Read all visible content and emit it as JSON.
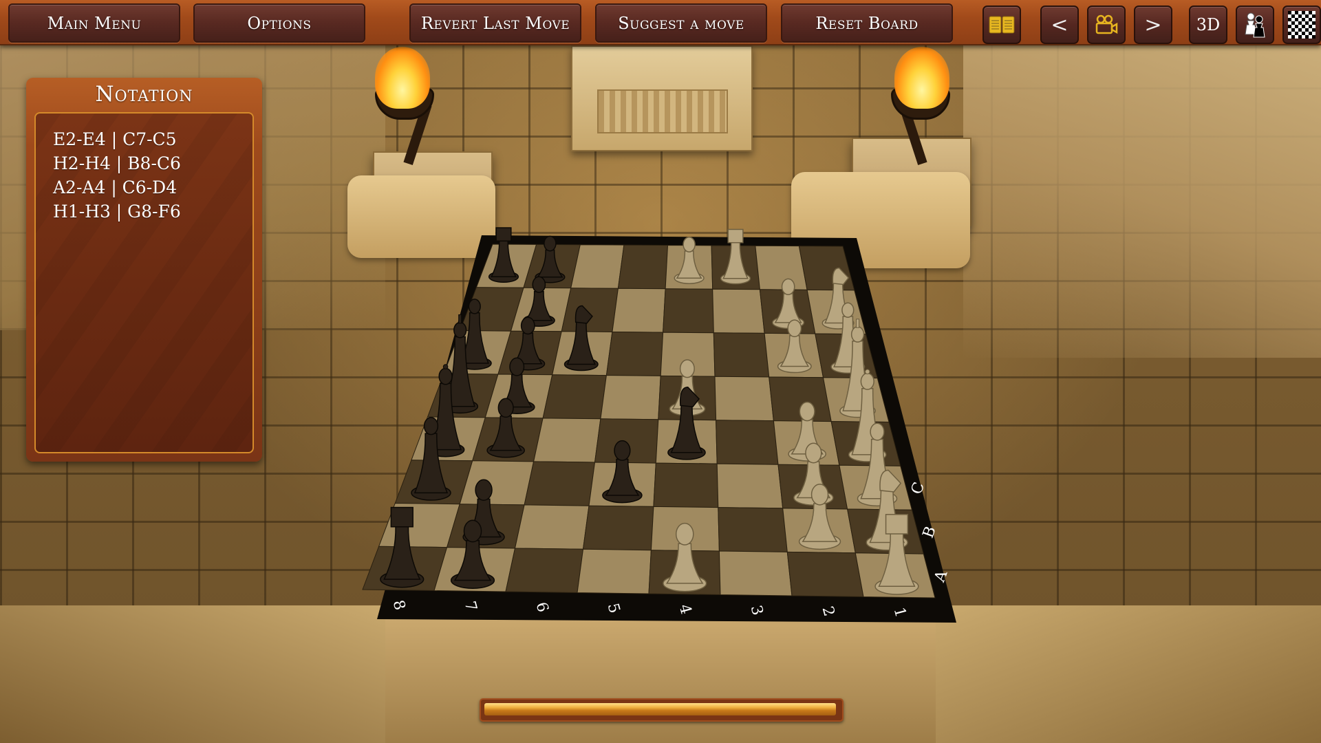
{
  "toolbar": {
    "buttons": [
      {
        "id": "main-menu",
        "label": "Main Menu"
      },
      {
        "id": "options",
        "label": "Options"
      },
      {
        "id": "revert-last-move",
        "label": "Revert Last Move"
      },
      {
        "id": "suggest-move",
        "label": "Suggest a move"
      },
      {
        "id": "reset-board",
        "label": "Reset Board"
      }
    ],
    "icons": [
      {
        "id": "notation-book",
        "icon": "open-book-icon",
        "glyph": "📖"
      },
      {
        "id": "previous",
        "icon": "chevron-left-icon",
        "glyph": "<"
      },
      {
        "id": "camera",
        "icon": "movie-camera-icon",
        "glyph": "🎥"
      },
      {
        "id": "next",
        "icon": "chevron-right-icon",
        "glyph": ">"
      },
      {
        "id": "view-3d",
        "icon": "3d-toggle-icon",
        "glyph": "3D"
      },
      {
        "id": "pieces",
        "icon": "pawns-icon",
        "glyph": "♟"
      },
      {
        "id": "board-style",
        "icon": "checkerboard-icon",
        "glyph": ""
      }
    ]
  },
  "notation": {
    "title": "Notation",
    "moves": [
      "E2-E4 | C7-C5",
      "H2-H4 | B8-C6",
      "A2-A4 | C6-D4",
      "H1-H3 | G8-F6"
    ]
  },
  "board": {
    "rank_labels": [
      "8",
      "7",
      "6",
      "5",
      "4",
      "3",
      "2",
      "1"
    ],
    "file_labels_visible": [
      "A",
      "B",
      "C"
    ],
    "colors": {
      "light": "#a08a60",
      "dark": "#4a3a22",
      "frame": "#0d0a06",
      "label": "#ffffff"
    },
    "pieces": [
      {
        "square": "a8",
        "color": "black",
        "type": "rook"
      },
      {
        "square": "c8",
        "color": "black",
        "type": "bishop"
      },
      {
        "square": "d8",
        "color": "black",
        "type": "queen"
      },
      {
        "square": "e8",
        "color": "black",
        "type": "king"
      },
      {
        "square": "f8",
        "color": "black",
        "type": "bishop"
      },
      {
        "square": "h8",
        "color": "black",
        "type": "rook"
      },
      {
        "square": "a7",
        "color": "black",
        "type": "pawn"
      },
      {
        "square": "b7",
        "color": "black",
        "type": "pawn"
      },
      {
        "square": "d7",
        "color": "black",
        "type": "pawn"
      },
      {
        "square": "e7",
        "color": "black",
        "type": "pawn"
      },
      {
        "square": "f7",
        "color": "black",
        "type": "pawn"
      },
      {
        "square": "g7",
        "color": "black",
        "type": "pawn"
      },
      {
        "square": "h7",
        "color": "black",
        "type": "pawn"
      },
      {
        "square": "f6",
        "color": "black",
        "type": "knight"
      },
      {
        "square": "c5",
        "color": "black",
        "type": "pawn"
      },
      {
        "square": "d4",
        "color": "black",
        "type": "knight"
      },
      {
        "square": "a1",
        "color": "white",
        "type": "rook"
      },
      {
        "square": "b1",
        "color": "white",
        "type": "knight"
      },
      {
        "square": "c1",
        "color": "white",
        "type": "bishop"
      },
      {
        "square": "d1",
        "color": "white",
        "type": "queen"
      },
      {
        "square": "e1",
        "color": "white",
        "type": "king"
      },
      {
        "square": "f1",
        "color": "white",
        "type": "bishop"
      },
      {
        "square": "g1",
        "color": "white",
        "type": "knight"
      },
      {
        "square": "b2",
        "color": "white",
        "type": "pawn"
      },
      {
        "square": "c2",
        "color": "white",
        "type": "pawn"
      },
      {
        "square": "d2",
        "color": "white",
        "type": "pawn"
      },
      {
        "square": "f2",
        "color": "white",
        "type": "pawn"
      },
      {
        "square": "g2",
        "color": "white",
        "type": "pawn"
      },
      {
        "square": "a4",
        "color": "white",
        "type": "pawn"
      },
      {
        "square": "e4",
        "color": "white",
        "type": "pawn"
      },
      {
        "square": "h4",
        "color": "white",
        "type": "pawn"
      },
      {
        "square": "h3",
        "color": "white",
        "type": "rook"
      }
    ],
    "piece_colors": {
      "white": "#b8a680",
      "black": "#2a2118"
    }
  },
  "progress": {
    "value": 1.0
  }
}
